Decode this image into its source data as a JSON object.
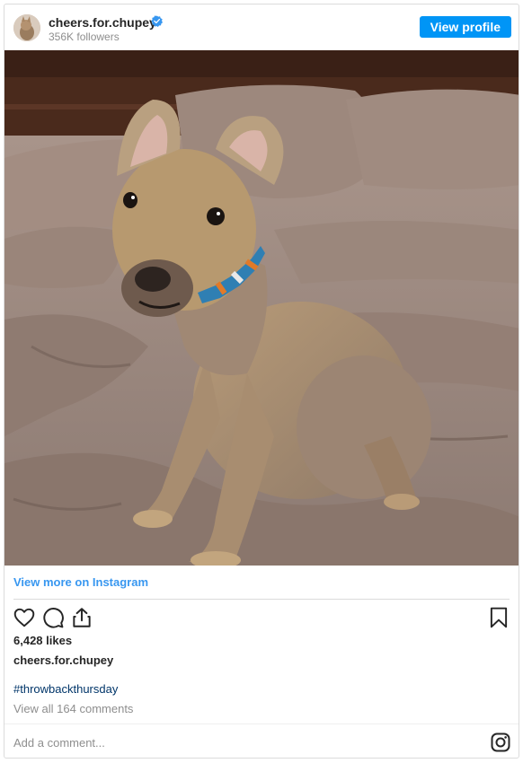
{
  "header": {
    "username": "cheers.for.chupey",
    "followers": "356K followers",
    "view_profile_label": "View profile",
    "verified_icon": "verified-badge-icon"
  },
  "post": {
    "photo_alt": "Puppy sitting on a bed",
    "view_more_label": "View more on Instagram",
    "likes": "6,428 likes",
    "owner": "cheers.for.chupey",
    "hashtag": "#throwbackthursday",
    "view_comments": "View all 164 comments",
    "add_comment_placeholder": "Add a comment..."
  },
  "icons": {
    "like": "heart-icon",
    "comment": "comment-icon",
    "share": "share-icon",
    "save": "bookmark-icon",
    "instagram": "instagram-icon"
  },
  "colors": {
    "accent": "#0095f6",
    "link": "#3897f0",
    "hashtag": "#003569",
    "muted": "#8e8e8e",
    "border": "#dbdbdb"
  }
}
